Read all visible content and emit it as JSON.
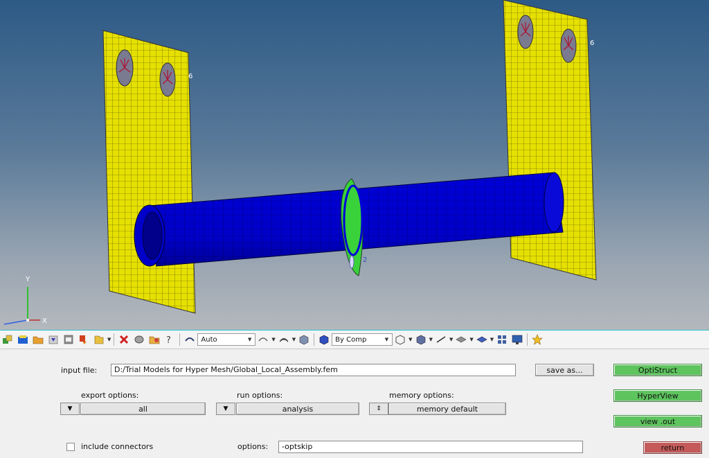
{
  "viewport": {
    "axis": {
      "x_label": "X",
      "y_label": "Y"
    },
    "node_labels": {
      "left_plate": "6",
      "right_plate": "6",
      "washer": "2"
    }
  },
  "toolbar": {
    "display_mode_select": "Auto",
    "color_by_select": "By Comp"
  },
  "panel": {
    "input_file_label": "input file:",
    "input_file_value": "D:/Trial Models for Hyper Mesh/Global_Local_Assembly.fem",
    "save_as_label": "save as...",
    "optistruct_label": "OptiStruct",
    "hyperview_label": "HyperView",
    "view_out_label": "view .out",
    "return_label": "return",
    "export_options_label": "export options:",
    "export_options_value": "all",
    "run_options_label": "run options:",
    "run_options_value": "analysis",
    "memory_options_label": "memory options:",
    "memory_options_value": "memory default",
    "include_connectors_label": "include connectors",
    "options_label": "options:",
    "options_value": "-optskip"
  },
  "colors": {
    "plate": "#e6e000",
    "tube": "#0000d8",
    "washer": "#3ad23a",
    "button_green": "#5ec45e",
    "button_red": "#c45a5a",
    "toolbar_border": "#2bc0d0"
  }
}
